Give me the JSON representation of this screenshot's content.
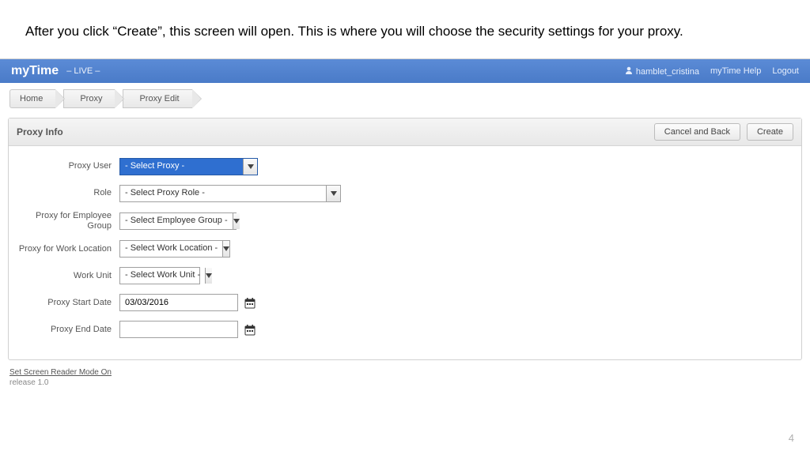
{
  "caption": "After you click “Create”, this screen will open.  This is where you will choose the security settings for your proxy.",
  "page_number": "4",
  "topbar": {
    "brand_prefix": "my",
    "brand_bold": "Time",
    "env": "– LIVE –",
    "username": "hamblet_cristina",
    "help_label": "myTime Help",
    "logout_label": "Logout"
  },
  "breadcrumbs": [
    "Home",
    "Proxy",
    "Proxy Edit"
  ],
  "panel": {
    "title": "Proxy Info",
    "cancel_label": "Cancel and Back",
    "create_label": "Create"
  },
  "form": {
    "proxy_user": {
      "label": "Proxy User",
      "value": "- Select Proxy -"
    },
    "role": {
      "label": "Role",
      "value": "- Select Proxy Role -"
    },
    "emp_group": {
      "label": "Proxy for Employee Group",
      "value": "- Select Employee Group -"
    },
    "work_loc": {
      "label": "Proxy for Work Location",
      "value": "- Select Work Location -"
    },
    "work_unit": {
      "label": "Work Unit",
      "value": "- Select Work Unit -"
    },
    "start_date": {
      "label": "Proxy Start Date",
      "value": "03/03/2016"
    },
    "end_date": {
      "label": "Proxy End Date",
      "value": ""
    }
  },
  "footer": {
    "screen_reader": "Set Screen Reader Mode On",
    "release": "release 1.0"
  }
}
